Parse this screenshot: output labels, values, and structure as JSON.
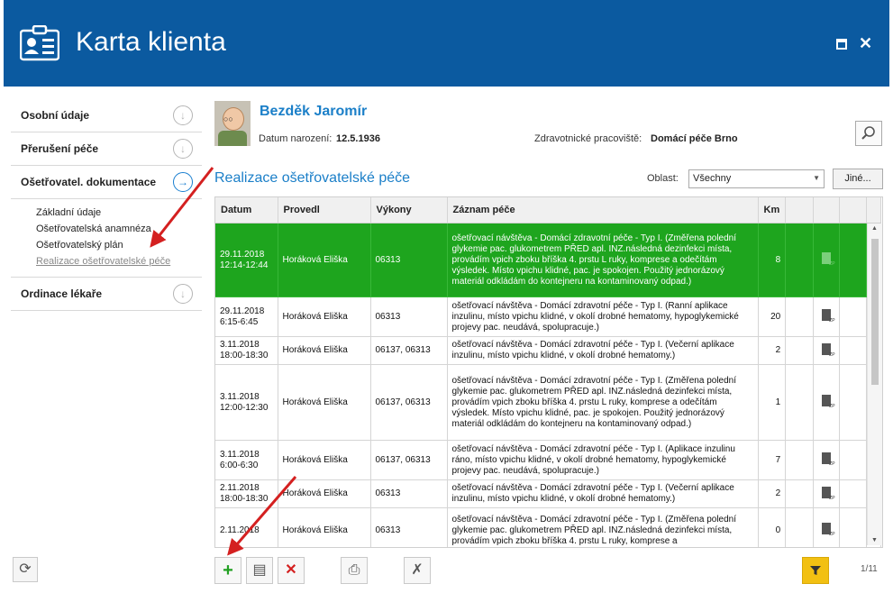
{
  "window": {
    "title": "Karta klienta"
  },
  "sidebar": {
    "items": [
      {
        "label": "Osobní údaje"
      },
      {
        "label": "Přerušení péče"
      },
      {
        "label": "Ošetřovatel. dokumentace"
      },
      {
        "label": "Ordinace lékaře"
      }
    ],
    "subitems": [
      "Základní údaje",
      "Ošetřovatelská anamnéza",
      "Ošetřovatelský plán",
      "Realizace ošetřovatelské péče"
    ]
  },
  "patient": {
    "name": "Bezděk Jaromír",
    "dob_label": "Datum narození:",
    "dob": "12.5.1936",
    "workplace_label": "Zdravotnické pracoviště:",
    "workplace": "Domácí péče Brno"
  },
  "section": {
    "title": "Realizace ošetřovatelské péče",
    "oblast_label": "Oblast:",
    "oblast_value": "Všechny",
    "jine_label": "Jiné..."
  },
  "table": {
    "headers": [
      "Datum",
      "Provedl",
      "Výkony",
      "Záznam péče",
      "Km"
    ],
    "rows": [
      {
        "date": "29.11.2018",
        "time": "12:14-12:44",
        "who": "Horáková Eliška",
        "codes": "06313",
        "note": "ošetřovací návštěva - Domácí zdravotní péče - Typ I. (Změřena polední glykemie pac. glukometrem PŘED apl. INZ.následná dezinfekci místa, provádím vpich zboku bříška 4. prstu L ruky, komprese a odečítám výsledek. Místo vpichu klidné, pac. je spokojen. Použitý jednorázový materiál odkládám do kontejneru na kontaminovaný odpad.)",
        "km": "8"
      },
      {
        "date": "29.11.2018",
        "time": "6:15-6:45",
        "who": "Horáková Eliška",
        "codes": "06313",
        "note": "ošetřovací návštěva - Domácí zdravotní péče - Typ I. (Ranní aplikace inzulinu,  místo vpichu klidné, v okolí drobné hematomy, hypoglykemické projevy pac. neudává, spolupracuje.)",
        "km": "20"
      },
      {
        "date": "3.11.2018",
        "time": "18:00-18:30",
        "who": "Horáková Eliška",
        "codes": "06137, 06313",
        "note": "ošetřovací návštěva - Domácí zdravotní péče - Typ I. (Večerní aplikace inzulinu, místo vpichu klidné, v okolí drobné hematomy.)",
        "km": "2"
      },
      {
        "date": "3.11.2018",
        "time": "12:00-12:30",
        "who": "Horáková Eliška",
        "codes": "06137, 06313",
        "note": "ošetřovací návštěva - Domácí zdravotní péče - Typ I. (Změřena polední glykemie pac. glukometrem PŘED apl. INZ.následná dezinfekci místa, provádím vpich zboku bříška 4. prstu L ruky, komprese a odečítám výsledek. Místo vpichu klidné, pac. je spokojen. Použitý jednorázový materiál odkládám do kontejneru na kontaminovaný odpad.)",
        "km": "1"
      },
      {
        "date": "3.11.2018",
        "time": "6:00-6:30",
        "who": "Horáková Eliška",
        "codes": "06137, 06313",
        "note": "ošetřovací návštěva - Domácí zdravotní péče - Typ I. (Aplikace inzulinu ráno,  místo vpichu klidné, v okolí drobné hematomy, hypoglykemické projevy pac. neudává, spolupracuje.)",
        "km": "7"
      },
      {
        "date": "2.11.2018",
        "time": "18:00-18:30",
        "who": "Horáková Eliška",
        "codes": "06313",
        "note": "ošetřovací návštěva - Domácí zdravotní péče - Typ I. (Večerní aplikace inzulinu, místo vpichu klidné, v okolí drobné hematomy.)",
        "km": "2"
      },
      {
        "date": "2.11.2018",
        "time": "",
        "who": "Horáková Eliška",
        "codes": "06313",
        "note": "ošetřovací návštěva - Domácí zdravotní péče - Typ I. (Změřena polední glykemie pac. glukometrem PŘED apl. INZ.následná dezinfekci místa, provádím vpich zboku bříška 4. prstu L ruky, komprese a",
        "km": "0"
      }
    ]
  },
  "pager": "1/11",
  "colors": {
    "titlebar": "#0b5aa0",
    "accent": "#1b7fc8",
    "selected_row": "#1ea51e",
    "arrow": "#d42020"
  }
}
